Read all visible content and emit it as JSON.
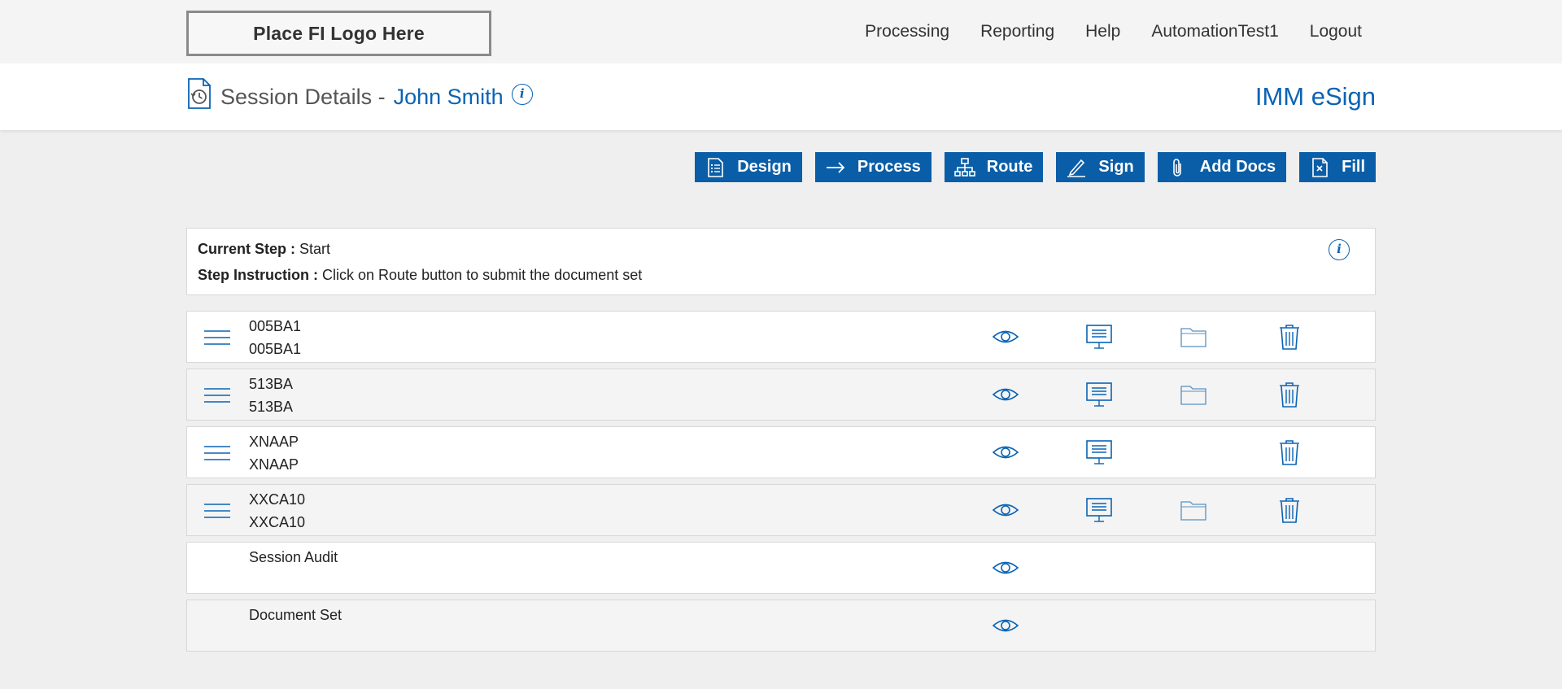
{
  "logo": {
    "text": "Place FI Logo Here"
  },
  "nav": [
    "Processing",
    "Reporting",
    "Help",
    "AutomationTest1",
    "Logout"
  ],
  "header": {
    "title": "Session Details -",
    "name": "John Smith",
    "info": "i",
    "brand": "IMM eSign"
  },
  "toolbar": [
    {
      "label": "Design",
      "icon": "design-icon"
    },
    {
      "label": "Process",
      "icon": "arrow-right-icon"
    },
    {
      "label": "Route",
      "icon": "route-icon"
    },
    {
      "label": "Sign",
      "icon": "pen-icon"
    },
    {
      "label": "Add Docs",
      "icon": "paperclip-icon"
    },
    {
      "label": "Fill",
      "icon": "fill-form-icon"
    }
  ],
  "step": {
    "current_label": "Current Step :",
    "current_value": "Start",
    "instruction_label": "Step Instruction :",
    "instruction_value": "Click on Route button to submit the document set",
    "info": "i"
  },
  "documents": [
    {
      "line1": "005BA1",
      "line2": "005BA1",
      "drag": true,
      "view": true,
      "screen": true,
      "folder": true,
      "trash": true
    },
    {
      "line1": "513BA",
      "line2": "513BA",
      "drag": true,
      "view": true,
      "screen": true,
      "folder": true,
      "trash": true
    },
    {
      "line1": "XNAAP",
      "line2": "XNAAP",
      "drag": true,
      "view": true,
      "screen": true,
      "folder": false,
      "trash": true
    },
    {
      "line1": "XXCA10",
      "line2": "XXCA10",
      "drag": true,
      "view": true,
      "screen": true,
      "folder": true,
      "trash": true
    },
    {
      "line1": "Session Audit",
      "line2": "",
      "drag": false,
      "view": true,
      "screen": false,
      "folder": false,
      "trash": false
    },
    {
      "line1": "Document Set",
      "line2": "",
      "drag": false,
      "view": true,
      "screen": false,
      "folder": false,
      "trash": false
    }
  ],
  "colors": {
    "accent": "#0a5ea8",
    "link": "#0a63b4"
  }
}
